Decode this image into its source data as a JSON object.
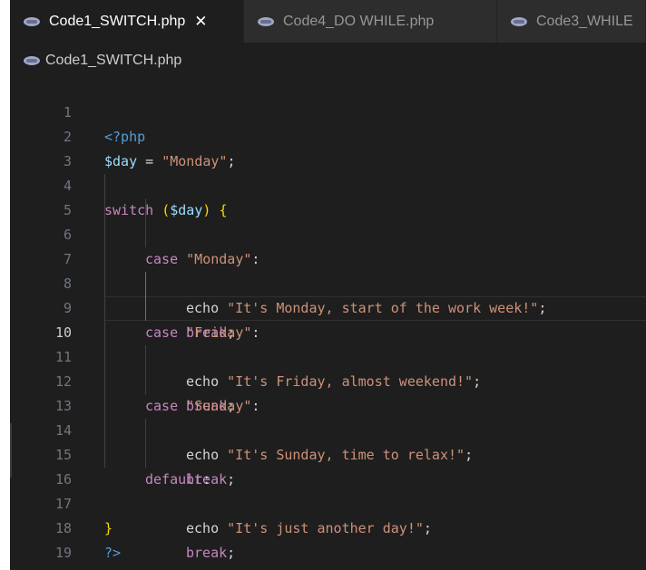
{
  "tabs": [
    {
      "label": "Code1_SWITCH.php",
      "close": "✕",
      "icon": "php-icon"
    },
    {
      "label": "Code4_DO WHILE.php",
      "icon": "php-icon"
    },
    {
      "label": "Code3_WHILE",
      "icon": "php-icon"
    }
  ],
  "breadcrumb": {
    "file": "Code1_SWITCH.php",
    "icon": "php-icon"
  },
  "current_line": 10,
  "code": {
    "line_numbers": [
      "1",
      "2",
      "3",
      "4",
      "5",
      "6",
      "7",
      "8",
      "9",
      "10",
      "11",
      "12",
      "13",
      "14",
      "15",
      "16",
      "17",
      "18",
      "19"
    ],
    "l1_tag": "<?php",
    "l2_var": "$day",
    "l2_eq": " = ",
    "l2_str": "\"Monday\"",
    "l2_semi": ";",
    "l4_kw": "switch",
    "l4_sp": " ",
    "l4_open": "(",
    "l4_var": "$day",
    "l4_close": ")",
    "l4_brace": "{",
    "case": "case",
    "colon": ":",
    "echo": "echo",
    "break": "break",
    "semi": ";",
    "l5_str": "\"Monday\"",
    "l6_str": "\"It's Monday, start of the work week!\"",
    "l8_str": "\"Friday\"",
    "l9_str": "\"It's Friday, almost weekend!\"",
    "l11_str": "\"Sunday\"",
    "l12_str": "\"It's Sunday, time to relax!\"",
    "l14_kw": "default",
    "l15_str": "\"It's just another day!\"",
    "l17_brace": "}",
    "l18_tag": "?>"
  }
}
